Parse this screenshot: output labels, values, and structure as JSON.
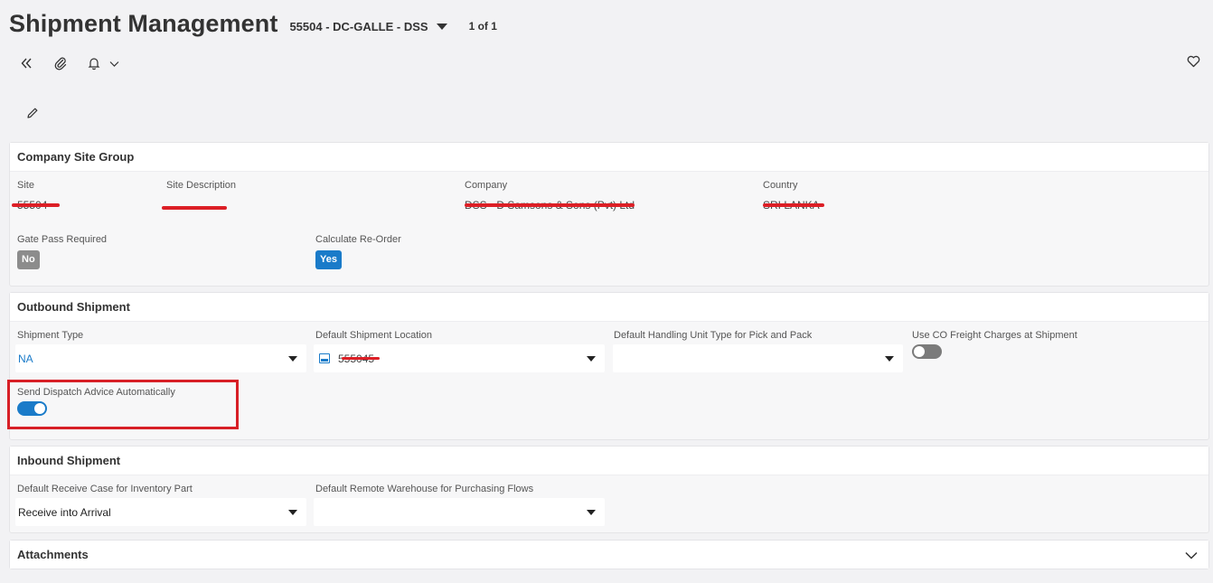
{
  "header": {
    "title": "Shipment Management",
    "record_selector": "55504 - DC-GALLE - DSS",
    "record_count": "1 of 1"
  },
  "toolbar": {
    "icons": [
      "double-chevron-left-icon",
      "paperclip-icon",
      "bell-icon",
      "chevron-down-icon",
      "heart-icon",
      "pencil-icon"
    ]
  },
  "company_site_group": {
    "title": "Company Site Group",
    "site_label": "Site",
    "site_value": "55504",
    "site_description_label": "Site Description",
    "company_label": "Company",
    "company_value": "DSS - D Samsons & Sons (Pvt) Ltd",
    "country_label": "Country",
    "country_value": "SRI LANKA",
    "gate_pass_label": "Gate Pass Required",
    "gate_pass_value": "No",
    "calc_reorder_label": "Calculate Re-Order",
    "calc_reorder_value": "Yes"
  },
  "outbound_shipment": {
    "title": "Outbound Shipment",
    "shipment_type_label": "Shipment Type",
    "shipment_type_value": "NA",
    "default_location_label": "Default Shipment Location",
    "default_location_value": "555045",
    "handling_unit_label": "Default Handling Unit Type for Pick and Pack",
    "handling_unit_value": "",
    "co_freight_label": "Use CO Freight Charges at Shipment",
    "co_freight_on": false,
    "dispatch_advice_label": "Send Dispatch Advice Automatically",
    "dispatch_advice_on": true
  },
  "inbound_shipment": {
    "title": "Inbound Shipment",
    "receive_case_label": "Default Receive Case for Inventory Part",
    "receive_case_value": "Receive into Arrival",
    "remote_warehouse_label": "Default Remote Warehouse for Purchasing Flows",
    "remote_warehouse_value": ""
  },
  "attachments": {
    "title": "Attachments"
  },
  "colors": {
    "accent": "#1a7bc9",
    "redaction": "#dc1f26",
    "highlight": "#d71f26"
  }
}
